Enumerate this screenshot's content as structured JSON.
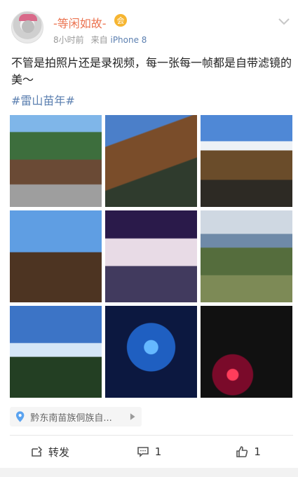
{
  "post": {
    "username": "-等闲如故-",
    "vip_badge": "会",
    "time": "8小时前",
    "source_prefix": "来自",
    "source_device": "iPhone 8",
    "text": "不管是拍照片还是录视频，每一张每一帧都是自带滤镜的美～",
    "hashtag": "#雷山苗年#"
  },
  "location": {
    "label": "黔东南苗族侗族自..."
  },
  "actions": {
    "repost_label": "转发",
    "comment_count": "1",
    "like_count": "1"
  },
  "icons": {
    "more": "chevron-down-icon",
    "location": "location-pin-icon",
    "repost": "repost-icon",
    "comment": "comment-icon",
    "like": "thumbs-up-icon"
  },
  "colors": {
    "username": "#eb7350",
    "link": "#5b7fb0",
    "muted": "#999999"
  }
}
